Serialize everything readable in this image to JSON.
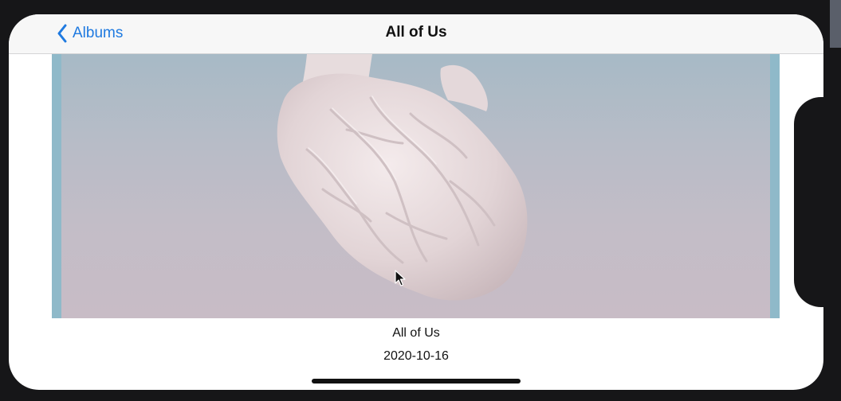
{
  "nav": {
    "back_label": "Albums",
    "title": "All of Us"
  },
  "photo": {
    "subject": "heart-illustration"
  },
  "caption": {
    "title": "All of Us",
    "date": "2020-10-16"
  },
  "colors": {
    "accent": "#1f7ae0",
    "nav_background": "#f7f7f7",
    "device_frame": "#161618"
  },
  "icons": {
    "back": "chevron-left-icon",
    "cursor": "mouse-pointer-icon"
  }
}
